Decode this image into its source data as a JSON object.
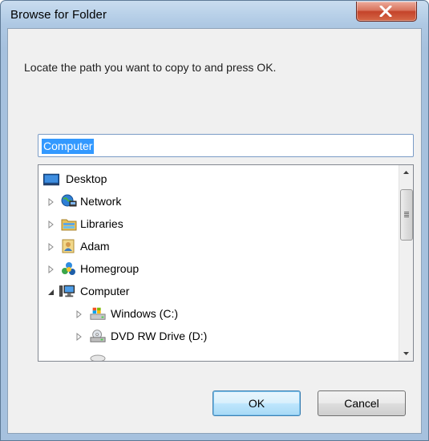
{
  "window": {
    "title": "Browse for Folder",
    "close_tooltip": "Close"
  },
  "instructions": "Locate the path you want to copy to and press OK.",
  "path_input": {
    "value": "Computer"
  },
  "tree": {
    "items": [
      {
        "label": "Desktop",
        "icon": "desktop-icon",
        "expander": "none"
      },
      {
        "label": "Network",
        "icon": "network-icon",
        "expander": "collapsed"
      },
      {
        "label": "Libraries",
        "icon": "libraries-icon",
        "expander": "collapsed"
      },
      {
        "label": "Adam",
        "icon": "user-folder-icon",
        "expander": "collapsed"
      },
      {
        "label": "Homegroup",
        "icon": "homegroup-icon",
        "expander": "collapsed"
      },
      {
        "label": "Computer",
        "icon": "computer-icon",
        "expander": "expanded"
      },
      {
        "label": "Windows (C:)",
        "icon": "windows-drive-icon",
        "expander": "collapsed"
      },
      {
        "label": "DVD RW Drive (D:)",
        "icon": "dvd-drive-icon",
        "expander": "collapsed"
      }
    ]
  },
  "buttons": {
    "ok": "OK",
    "cancel": "Cancel"
  },
  "colors": {
    "selection": "#3399ff",
    "close_button": "#c4432a",
    "frame": "#aec8e3",
    "client": "#f0f0f0"
  }
}
